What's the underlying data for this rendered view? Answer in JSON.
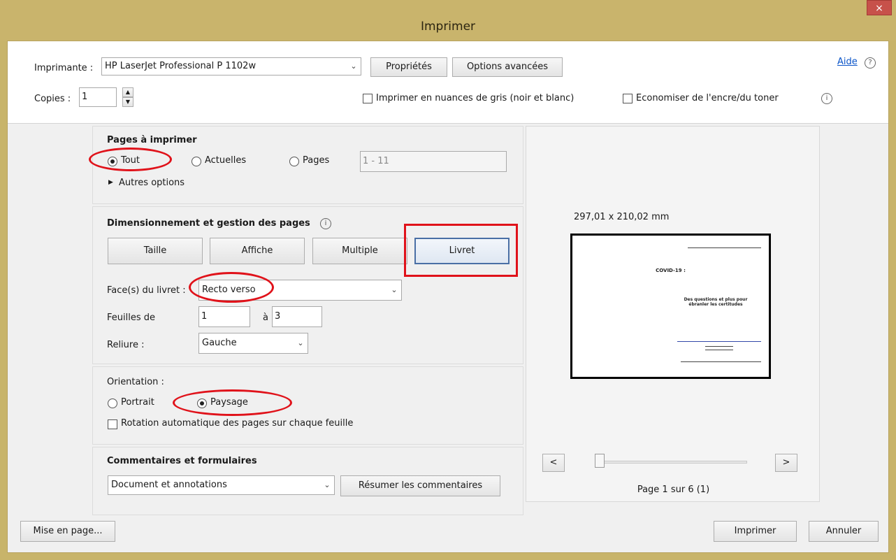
{
  "window": {
    "title": "Imprimer",
    "close": "×"
  },
  "printer": {
    "label": "Imprimante :",
    "value": "HP LaserJet Professional P 1102w",
    "properties_button": "Propriétés",
    "advanced_button": "Options avancées",
    "help_link": "Aide",
    "help_icon": "?"
  },
  "copies": {
    "label": "Copies :",
    "value": "1",
    "grayscale_label": "Imprimer en nuances de gris (noir et blanc)",
    "save_ink_label": "Economiser de l'encre/du toner",
    "info_icon": "i"
  },
  "pages_section": {
    "title": "Pages à imprimer",
    "options": [
      "Tout",
      "Actuelles",
      "Pages"
    ],
    "selected": "Tout",
    "range_value": "1 - 11",
    "more_options": "Autres options"
  },
  "sizing_section": {
    "title": "Dimensionnement et gestion des pages",
    "tabs": [
      "Taille",
      "Affiche",
      "Multiple",
      "Livret"
    ],
    "active_tab": "Livret",
    "booklet_sides_label": "Face(s) du livret :",
    "booklet_sides_value": "Recto verso",
    "sheets_label": "Feuilles de",
    "sheets_from": "1",
    "sheets_to_label": "à",
    "sheets_to": "3",
    "binding_label": "Reliure :",
    "binding_value": "Gauche"
  },
  "orientation_section": {
    "title": "Orientation :",
    "options": [
      "Portrait",
      "Paysage"
    ],
    "selected": "Paysage",
    "auto_rotate_label": "Rotation automatique des pages sur chaque feuille"
  },
  "comments_section": {
    "title": "Commentaires et formulaires",
    "dropdown_value": "Document et annotations",
    "summarize_button": "Résumer les commentaires"
  },
  "preview": {
    "dimensions": "297,01 x 210,02 mm",
    "prev_button": "<",
    "next_button": ">",
    "page_status": "Page 1 sur 6 (1)",
    "page_title": "COVID-19 :",
    "page_subtitle": "Des questions et plus pour ébranler les certitudes"
  },
  "footer": {
    "page_setup_button": "Mise en page...",
    "print_button": "Imprimer",
    "cancel_button": "Annuler"
  },
  "colors": {
    "titlebar": "#c9b46c",
    "highlight": "#e0121a",
    "close": "#c7514a"
  }
}
